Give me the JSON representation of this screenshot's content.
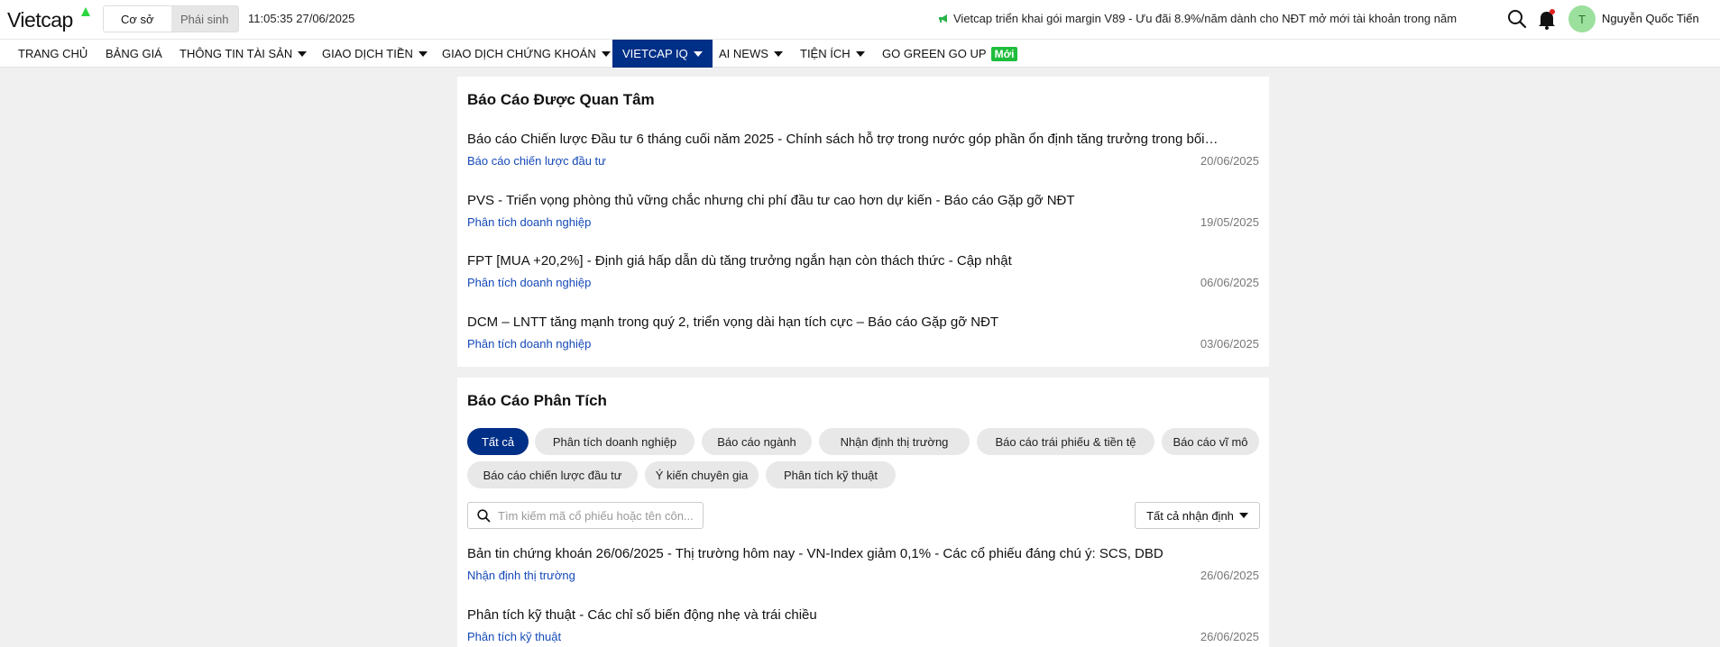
{
  "header": {
    "logo": "Vietcap",
    "segments": [
      "Cơ sở",
      "Phái sinh"
    ],
    "clock": "11:05:35 27/06/2025",
    "promo": "Vietcap triển khai gói margin V89 - Ưu đãi 8.9%/năm dành cho NĐT mở mới tài khoản trong năm",
    "avatar_initial": "T",
    "username": "Nguyễn Quốc Tiến",
    "icons": {
      "search": "search-icon",
      "bell": "bell-icon",
      "promo": "megaphone-icon"
    },
    "accent": "#2bd640"
  },
  "nav": [
    {
      "label": "TRANG CHỦ",
      "dropdown": false
    },
    {
      "label": "BẢNG GIÁ",
      "dropdown": false
    },
    {
      "label": "THÔNG TIN TÀI SẢN",
      "dropdown": true
    },
    {
      "label": "GIAO DỊCH TIỀN",
      "dropdown": true
    },
    {
      "label": "GIAO DỊCH CHỨNG KHOÁN",
      "dropdown": true
    },
    {
      "label": "VIETCAP IQ",
      "dropdown": true,
      "active": true
    },
    {
      "label": "AI NEWS",
      "dropdown": true
    },
    {
      "label": "TIỆN ÍCH",
      "dropdown": true
    },
    {
      "label": "GO GREEN GO UP",
      "dropdown": false,
      "badge": "Mới"
    }
  ],
  "featured": {
    "title": "Báo Cáo Được Quan Tâm",
    "reports": [
      {
        "title": "Báo cáo Chiến lược Đầu tư 6 tháng cuối năm 2025 - Chính sách hỗ trợ trong nước góp phần ổn định tăng trưởng trong bối…",
        "category": "Báo cáo chiến lược đầu tư",
        "date": "20/06/2025"
      },
      {
        "title": "PVS - Triển vọng phòng thủ vững chắc nhưng chi phí đầu tư cao hơn dự kiến - Báo cáo Gặp gỡ NĐT",
        "category": "Phân tích doanh nghiệp",
        "date": "19/05/2025"
      },
      {
        "title": "FPT [MUA +20,2%] - Định giá hấp dẫn dù tăng trưởng ngắn hạn còn thách thức - Cập nhật",
        "category": "Phân tích doanh nghiệp",
        "date": "06/06/2025"
      },
      {
        "title": "DCM – LNTT tăng mạnh trong quý 2, triển vọng dài hạn tích cực – Báo cáo Gặp gỡ NĐT",
        "category": "Phân tích doanh nghiệp",
        "date": "03/06/2025"
      }
    ]
  },
  "analysis": {
    "title": "Báo Cáo Phân Tích",
    "chips": [
      "Tất cả",
      "Phân tích doanh nghiệp",
      "Báo cáo ngành",
      "Nhận định thị trường",
      "Báo cáo trái phiếu & tiền tệ",
      "Báo cáo vĩ mô",
      "Báo cáo chiến lược đầu tư",
      "Ý kiến chuyên gia",
      "Phân tích kỹ thuật"
    ],
    "active_chip": "Tất cả",
    "search_placeholder": "Tìm kiếm mã cổ phiếu hoặc tên côn...",
    "filter_label": "Tất cả nhận định",
    "reports": [
      {
        "title": "Bản tin chứng khoán 26/06/2025 - Thị trường hôm nay - VN-Index giảm 0,1% - Các cổ phiếu đáng chú ý: SCS, DBD",
        "category": "Nhận định thị trường",
        "date": "26/06/2025"
      },
      {
        "title": "Phân tích kỹ thuật - Các chỉ số biến động nhẹ và trái chiều",
        "category": "Phân tích kỹ thuật",
        "date": "26/06/2025"
      }
    ]
  },
  "colors": {
    "brand": "#002f87",
    "link": "#1549b8",
    "new_badge": "#1fbd3c"
  }
}
